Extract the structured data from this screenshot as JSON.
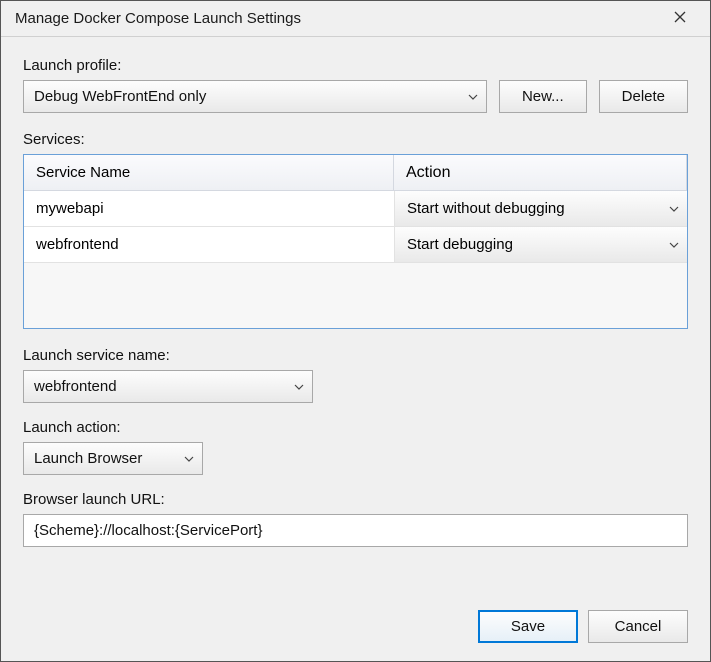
{
  "window": {
    "title": "Manage Docker Compose Launch Settings"
  },
  "labels": {
    "launch_profile": "Launch profile:",
    "services": "Services:",
    "launch_service_name": "Launch service name:",
    "launch_action": "Launch action:",
    "browser_launch_url": "Browser launch URL:"
  },
  "profile": {
    "selected": "Debug WebFrontEnd only",
    "new_btn": "New...",
    "delete_btn": "Delete"
  },
  "grid": {
    "col_service": "Service Name",
    "col_action": "Action",
    "rows": [
      {
        "service": "mywebapi",
        "action": "Start without debugging"
      },
      {
        "service": "webfrontend",
        "action": "Start debugging"
      }
    ]
  },
  "launch_service": {
    "selected": "webfrontend"
  },
  "launch_action": {
    "selected": "Launch Browser"
  },
  "browser_url": {
    "value": "{Scheme}://localhost:{ServicePort}"
  },
  "footer": {
    "save": "Save",
    "cancel": "Cancel"
  }
}
